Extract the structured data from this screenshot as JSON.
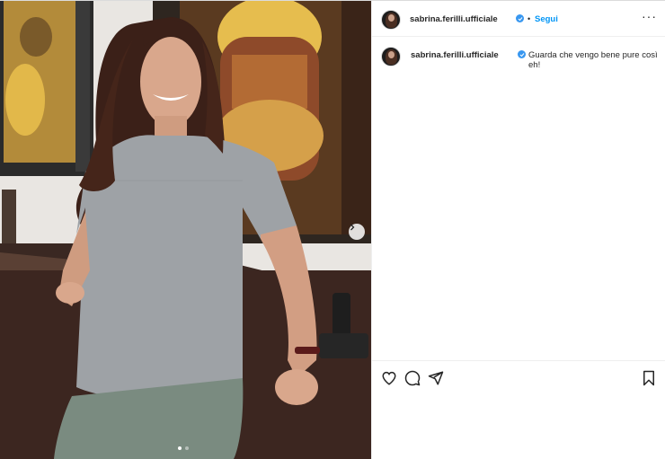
{
  "post": {
    "author": {
      "username": "sabrina.ferilli.ufficiale",
      "verified": true
    },
    "separator": "•",
    "follow_label": "Segui",
    "more_label": "···",
    "caption": "Guarda che vengo bene pure così eh!"
  },
  "media": {
    "image_description": "woman in grey t-shirt leaning on a desk in front of a painting",
    "current_slide": 1,
    "total_slides": 2
  },
  "icons": {
    "like": "heart-icon",
    "comment": "comment-icon",
    "share": "share-icon",
    "save": "bookmark-icon",
    "next": "chevron-right-icon",
    "verified": "verified-badge-icon",
    "more": "more-options-icon"
  },
  "colors": {
    "accent": "#0095f6",
    "verified": "#3897f0",
    "text": "#262626",
    "border": "#efefef"
  }
}
